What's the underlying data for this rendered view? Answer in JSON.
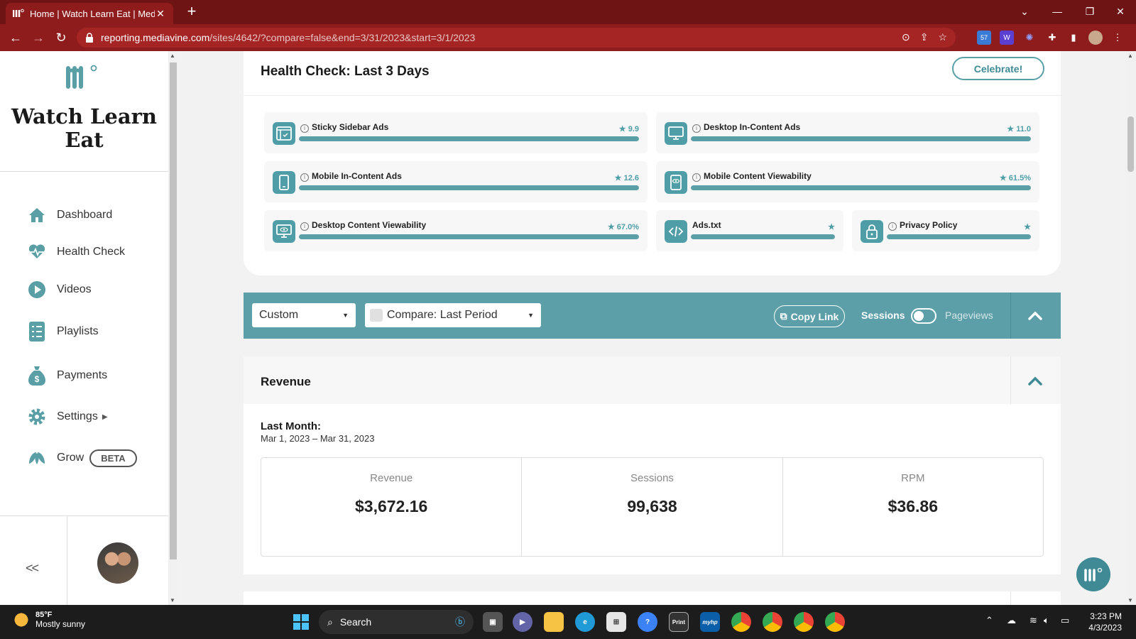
{
  "browser": {
    "tab_title": "Home | Watch Learn Eat | Mediav",
    "url_host": "reporting.mediavine.com",
    "url_path": "/sites/4642/?compare=false&end=3/31/2023&start=3/1/2023"
  },
  "sidebar": {
    "site_name": "Watch Learn Eat",
    "items": [
      {
        "label": "Dashboard",
        "icon": "home-icon"
      },
      {
        "label": "Health Check",
        "icon": "heartbeat-icon"
      },
      {
        "label": "Videos",
        "icon": "play-icon"
      },
      {
        "label": "Playlists",
        "icon": "list-icon"
      },
      {
        "label": "Payments",
        "icon": "money-bag-icon"
      },
      {
        "label": "Settings",
        "icon": "gear-icon"
      },
      {
        "label": "Grow",
        "icon": "leaf-icon",
        "badge": "BETA"
      }
    ],
    "collapse_label": "<<"
  },
  "health_check": {
    "title": "Health Check: Last 3 Days",
    "celebrate_label": "Celebrate!",
    "metrics": [
      {
        "label": "Sticky Sidebar Ads",
        "value": "9.9",
        "progress": 1.0
      },
      {
        "label": "Desktop In-Content Ads",
        "value": "11.0",
        "progress": 1.0
      },
      {
        "label": "Mobile In-Content Ads",
        "value": "12.6",
        "progress": 1.0
      },
      {
        "label": "Mobile Content Viewability",
        "value": "61.5%",
        "progress": 1.0
      },
      {
        "label": "Desktop Content Viewability",
        "value": "67.0%",
        "progress": 1.0
      },
      {
        "label": "Ads.txt",
        "value": "",
        "progress": 1.0
      },
      {
        "label": "Privacy Policy",
        "value": "",
        "progress": 1.0
      }
    ]
  },
  "filters": {
    "range_select": "Custom",
    "compare_select": "Compare: Last Period",
    "copy_link_label": "Copy Link",
    "toggle_left": "Sessions",
    "toggle_right": "Pageviews"
  },
  "revenue": {
    "title": "Revenue",
    "period_label": "Last Month:",
    "period_range": "Mar 1, 2023 – Mar 31, 2023",
    "stats": [
      {
        "label": "Revenue",
        "value": "$3,672.16"
      },
      {
        "label": "Sessions",
        "value": "99,638"
      },
      {
        "label": "RPM",
        "value": "$36.86"
      }
    ]
  },
  "taskbar": {
    "temp": "85°F",
    "condition": "Mostly sunny",
    "search_label": "Search",
    "time": "3:23 PM",
    "date": "4/3/2023"
  },
  "colors": {
    "brand_red": "#8f1c1c",
    "teal": "#5c9fa8"
  }
}
